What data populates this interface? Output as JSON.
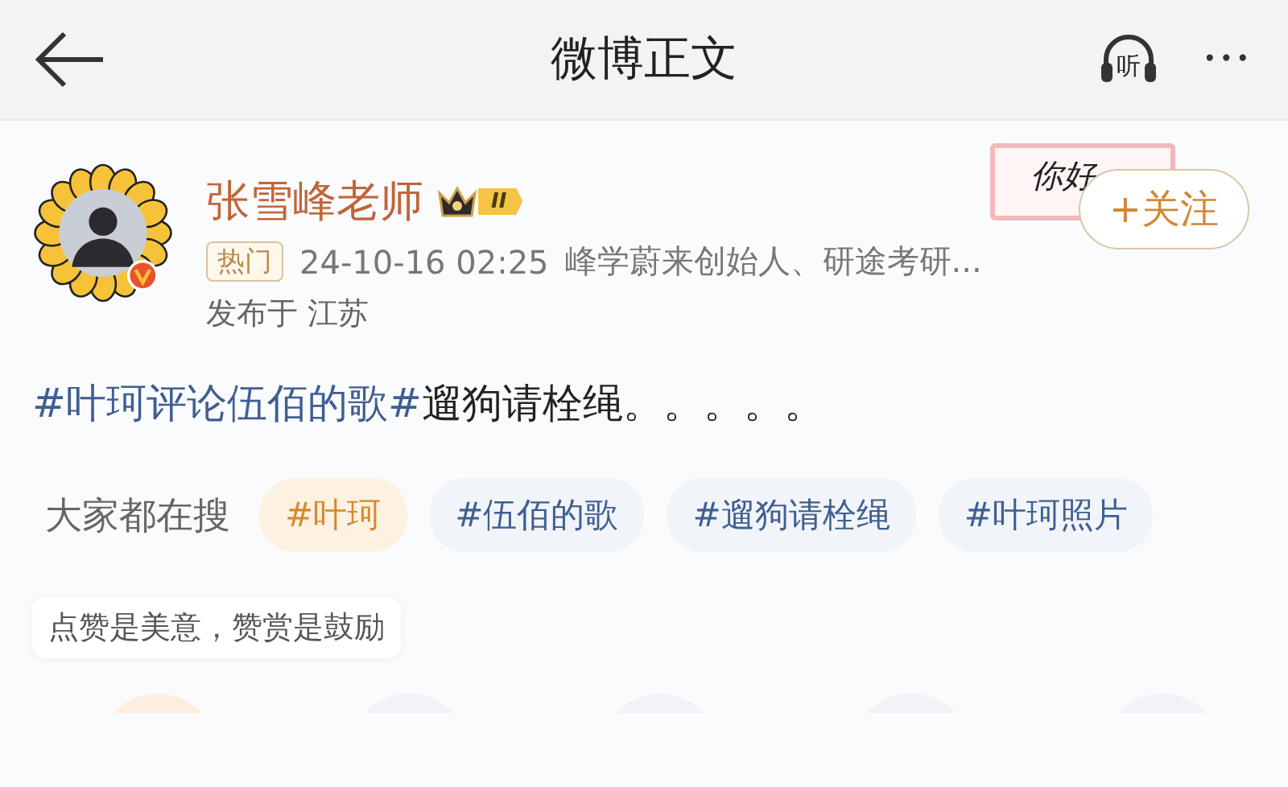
{
  "header": {
    "title": "微博正文",
    "listen_label": "听",
    "more": "•••"
  },
  "post": {
    "author": "张雪峰老师",
    "level_badge": "II",
    "verified": true,
    "sticker_text": "你好",
    "follow_button": "+关注",
    "hot_tag": "热门",
    "time": "24-10-16 02:25",
    "bio": "峰学蔚来创始人、研途考研...",
    "location": "发布于 江苏",
    "topic": "#叶珂评论伍佰的歌#",
    "text": "遛狗请栓绳。。。。。"
  },
  "search": {
    "label": "大家都在搜",
    "chips": [
      {
        "text": "#叶珂",
        "highlighted": true
      },
      {
        "text": "#伍佰的歌",
        "highlighted": false
      },
      {
        "text": "#遛狗请栓绳",
        "highlighted": false
      },
      {
        "text": "#叶珂照片",
        "highlighted": false
      }
    ]
  },
  "reward_hint": "点赞是美意，赞赏是鼓励"
}
